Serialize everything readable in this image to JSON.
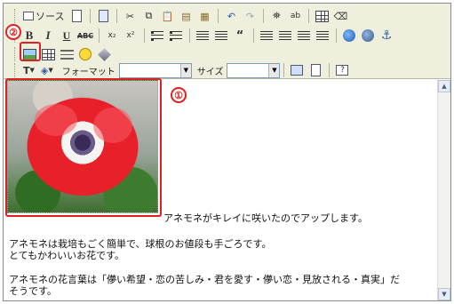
{
  "toolbar": {
    "source_label": "ソース",
    "format_label": "フォーマット",
    "format_value": "",
    "size_label": "サイズ",
    "size_value": ""
  },
  "annotations": {
    "image_number": "①",
    "button_number": "②",
    "accent_color": "#e02020"
  },
  "content": {
    "caption": "アネモネがキレイに咲いたのでアップします。",
    "paragraph1_line1": "アネモネは栽培もごく簡単で、球根のお値段も手ごろです。",
    "paragraph1_line2": "とてもかわいいお花です。",
    "paragraph2_line1": "アネモネの花言葉は「儚い希望・恋の苦しみ・君を愛す・儚い恋・見放される・真実」だ",
    "paragraph2_line2": "そうです。"
  }
}
